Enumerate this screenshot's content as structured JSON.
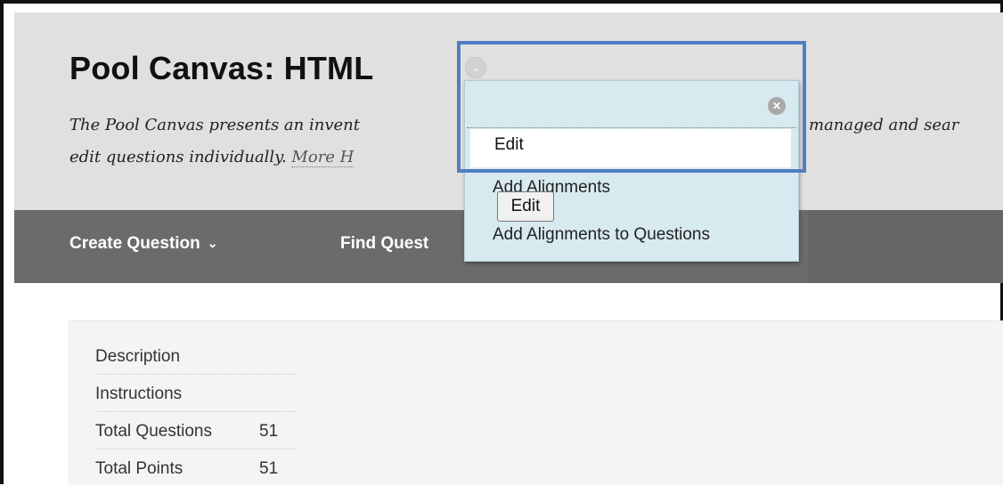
{
  "header": {
    "title": "Pool Canvas: HTML",
    "description_line1": "The Pool Canvas presents an invent",
    "description_line1_right": "managed and sear",
    "description_line2": "edit questions individually.",
    "more_help": "More H"
  },
  "toolbar": {
    "create_question": "Create Question",
    "find_questions": "Find Quest"
  },
  "dropdown_menu": {
    "items": [
      "Edit",
      "Add Alignments",
      "Add Alignments to Questions"
    ],
    "tooltip": "Edit"
  },
  "info": {
    "description_label": "Description",
    "instructions_label": "Instructions",
    "total_questions_label": "Total Questions",
    "total_questions_value": "51",
    "total_points_label": "Total Points",
    "total_points_value": "51"
  },
  "colors": {
    "header_bg": "#e0e0e0",
    "toolbar_bg": "#6b6b6b",
    "dropdown_bg": "#d7eaf0",
    "highlight": "#4f7ec4"
  }
}
